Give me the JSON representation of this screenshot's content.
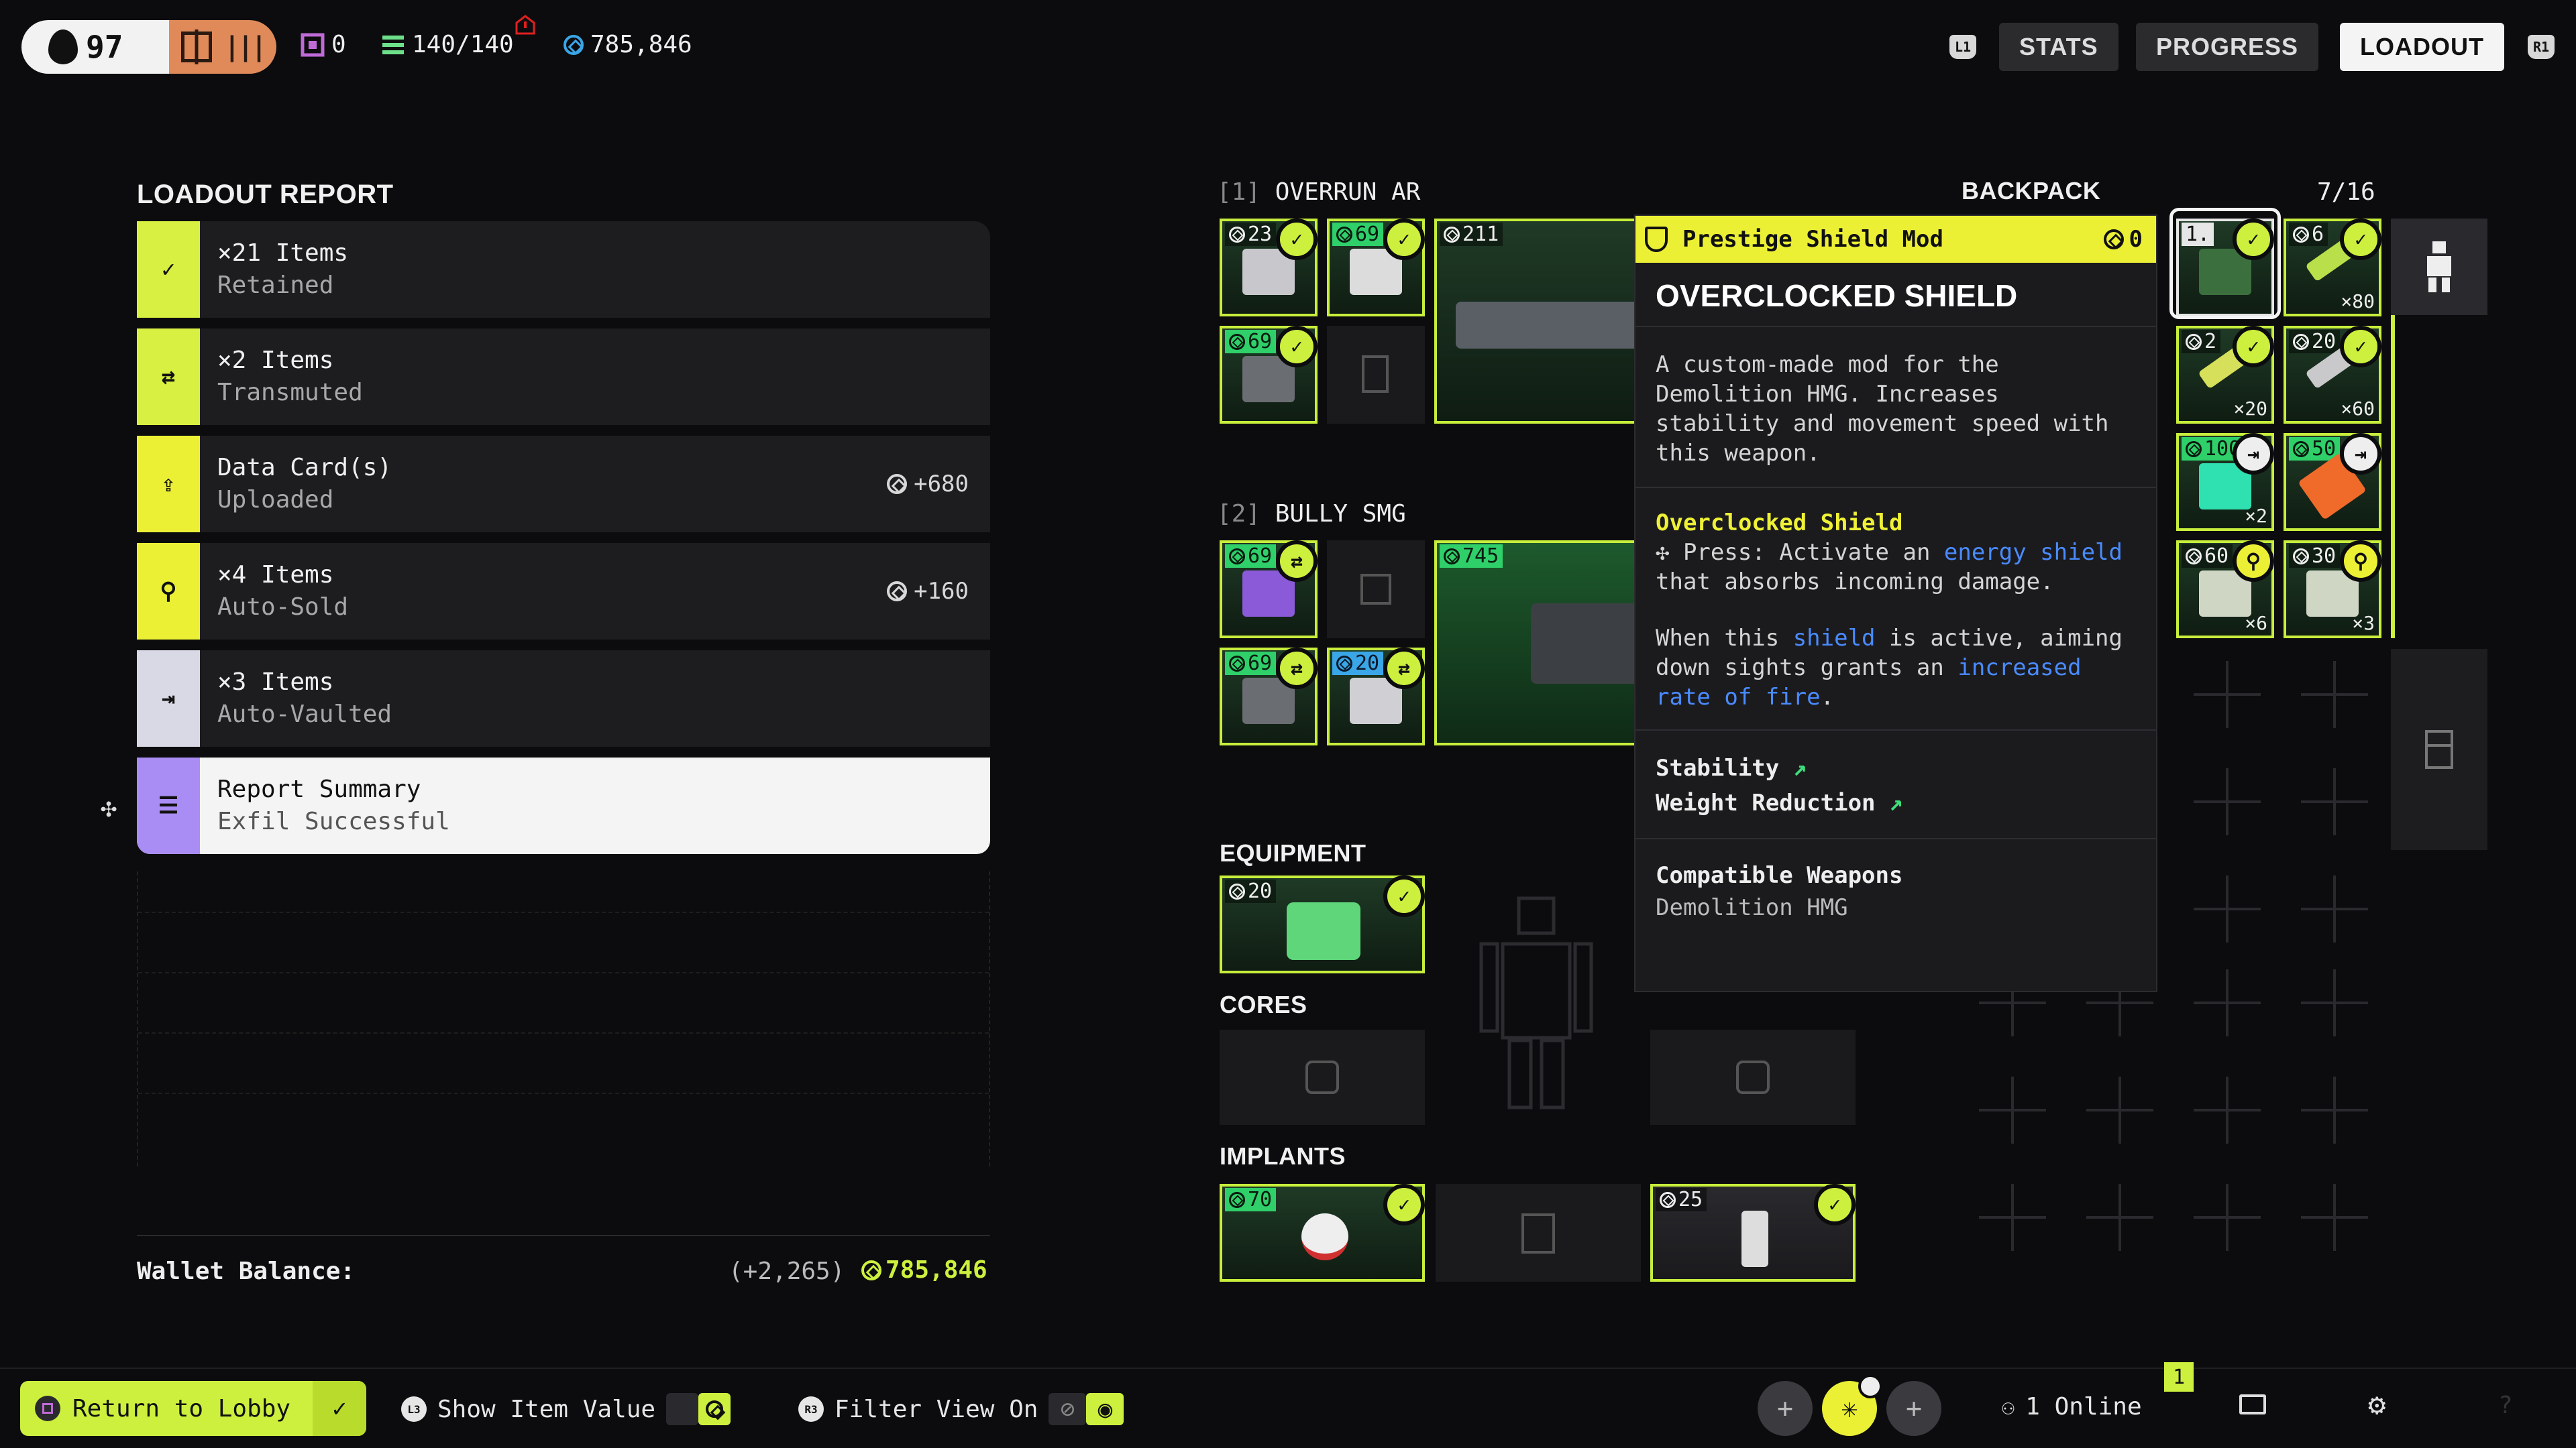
{
  "topbar": {
    "level": "97",
    "stats": [
      {
        "icon": "data-card-icon",
        "value": "0"
      },
      {
        "icon": "stack-icon",
        "value": "140/140"
      },
      {
        "icon": "currency-icon",
        "value": "785,846"
      }
    ],
    "nav": {
      "left_shoulder": "L1",
      "right_shoulder": "R1",
      "tabs": [
        "STATS",
        "PROGRESS",
        "LOADOUT"
      ],
      "active": "LOADOUT"
    }
  },
  "report": {
    "title": "LOADOUT REPORT",
    "rows": [
      {
        "line1": "×21 Items",
        "line2": "Retained",
        "value": "",
        "badge_color": "#d7f041",
        "icon": "check-icon"
      },
      {
        "line1": "×2 Items",
        "line2": "Transmuted",
        "value": "",
        "badge_color": "#d7f041",
        "icon": "transmute-icon"
      },
      {
        "line1": "Data Card(s)",
        "line2": "Uploaded",
        "value": "+680",
        "badge_color": "#ecf035",
        "icon": "upload-icon"
      },
      {
        "line1": "×4 Items",
        "line2": "Auto-Sold",
        "value": "+160",
        "badge_color": "#ecf035",
        "icon": "sell-icon"
      },
      {
        "line1": "×3 Items",
        "line2": "Auto-Vaulted",
        "value": "",
        "badge_color": "#d9d9e6",
        "icon": "vault-icon"
      },
      {
        "line1": "Report Summary",
        "line2": "Exfil Successful",
        "value": "",
        "badge_color": "#a98df4",
        "icon": "list-icon"
      }
    ],
    "wallet_label": "Wallet Balance:",
    "wallet_delta": "(+2,265)",
    "wallet_value": "785,846"
  },
  "weapons": [
    {
      "slot": "[1]",
      "name": "OVERRUN AR",
      "main_cost": "211",
      "mods": [
        "23",
        "69",
        "69"
      ]
    },
    {
      "slot": "[2]",
      "name": "BULLY SMG",
      "main_cost": "745",
      "mods": [
        "69",
        "69",
        "20"
      ]
    }
  ],
  "sections": {
    "equipment": "EQUIPMENT",
    "equipment_cost": "20",
    "cores": "CORES",
    "implants": "IMPLANTS",
    "implant_costs": [
      "70",
      "25"
    ]
  },
  "backpack": {
    "title": "BACKPACK",
    "count": "7/16",
    "items": [
      {
        "cost": "1.",
        "qty": ""
      },
      {
        "cost": "6",
        "qty": "×80"
      },
      {
        "cost": "2",
        "qty": "×20"
      },
      {
        "cost": "20",
        "qty": "×60"
      },
      {
        "cost": "100",
        "qty": "×2"
      },
      {
        "cost": "50",
        "qty": ""
      },
      {
        "cost": "60",
        "qty": "×6"
      },
      {
        "cost": "30",
        "qty": "×3"
      }
    ]
  },
  "tooltip": {
    "header": "Prestige Shield Mod",
    "cost": "0",
    "title": "OVERCLOCKED SHIELD",
    "description": "A custom-made mod for the Demolition HMG. Increases stability and movement speed with this weapon.",
    "ability_name": "Overclocked Shield",
    "press_pre": "Press: Activate an ",
    "press_hl": "energy shield",
    "press_post": " that absorbs incoming damage.",
    "when_pre": "When this ",
    "when_hl1": "shield",
    "when_mid": " is active, aiming down sights grants an ",
    "when_hl2": "increased rate of fire",
    "when_post": ".",
    "mod1": "Stability",
    "mod2": "Weight Reduction",
    "compat_label": "Compatible Weapons",
    "compat_value": "Demolition HMG"
  },
  "bottombar": {
    "return_label": "Return to Lobby",
    "show_value_btn": "L3",
    "show_value_label": "Show Item Value",
    "filter_btn": "R3",
    "filter_label": "Filter View On",
    "online_label": "1 Online",
    "notification_count": "1",
    "help": "?"
  }
}
